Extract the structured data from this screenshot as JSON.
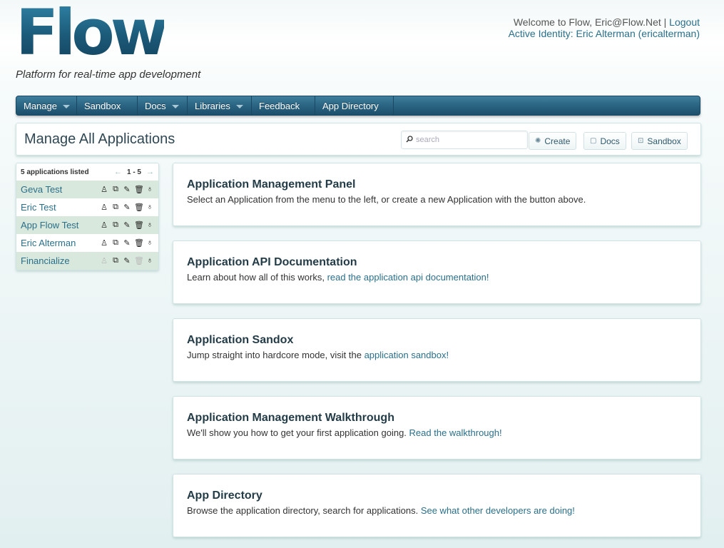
{
  "header": {
    "logo_text": "Flow",
    "tagline": "Platform for real-time app development",
    "welcome": "Welcome to Flow, Eric@Flow.Net",
    "separator": "|",
    "logout_label": "Logout",
    "identity_label": "Active Identity:",
    "identity_value": "Eric Alterman (ericalterman)"
  },
  "nav": {
    "items": [
      {
        "label": "Manage",
        "dropdown": true
      },
      {
        "label": "Sandbox",
        "dropdown": false
      },
      {
        "label": "Docs",
        "dropdown": true
      },
      {
        "label": "Libraries",
        "dropdown": true
      },
      {
        "label": "Feedback",
        "dropdown": false
      },
      {
        "label": "App Directory",
        "dropdown": false
      }
    ]
  },
  "titlebar": {
    "title": "Manage All Applications",
    "search_placeholder": "search",
    "create_label": "Create",
    "docs_label": "Docs",
    "sandbox_label": "Sandbox"
  },
  "sidebar": {
    "count_label": "5 applications listed",
    "range": "1 - 5",
    "prev_arrow": "←",
    "next_arrow": "→",
    "apps": [
      {
        "name": "Geva Test"
      },
      {
        "name": "Eric Test"
      },
      {
        "name": "App Flow Test"
      },
      {
        "name": "Eric Alterman"
      },
      {
        "name": "Financialize"
      }
    ]
  },
  "panels": [
    {
      "title": "Application Management Panel",
      "text": "Select an Application from the menu to the left, or create a new Application with the button above.",
      "link": ""
    },
    {
      "title": "Application API Documentation",
      "text": "Learn about how all of this works, ",
      "link": "read the application api documentation!"
    },
    {
      "title": "Application Sandox",
      "text": "Jump straight into hardcore mode, visit the ",
      "link": "application sandbox!"
    },
    {
      "title": "Application Management Walkthrough",
      "text": "We'll show you how to get your first application going. ",
      "link": "Read the walkthrough!"
    },
    {
      "title": "App Directory",
      "text": "Browse the application directory, search for applications. ",
      "link": "See what other developers are doing!"
    }
  ],
  "colors": {
    "brand": "#1f5f80",
    "nav": "#2a6482",
    "link": "#2a6f8a",
    "row_highlight": "#d9e8dc"
  }
}
